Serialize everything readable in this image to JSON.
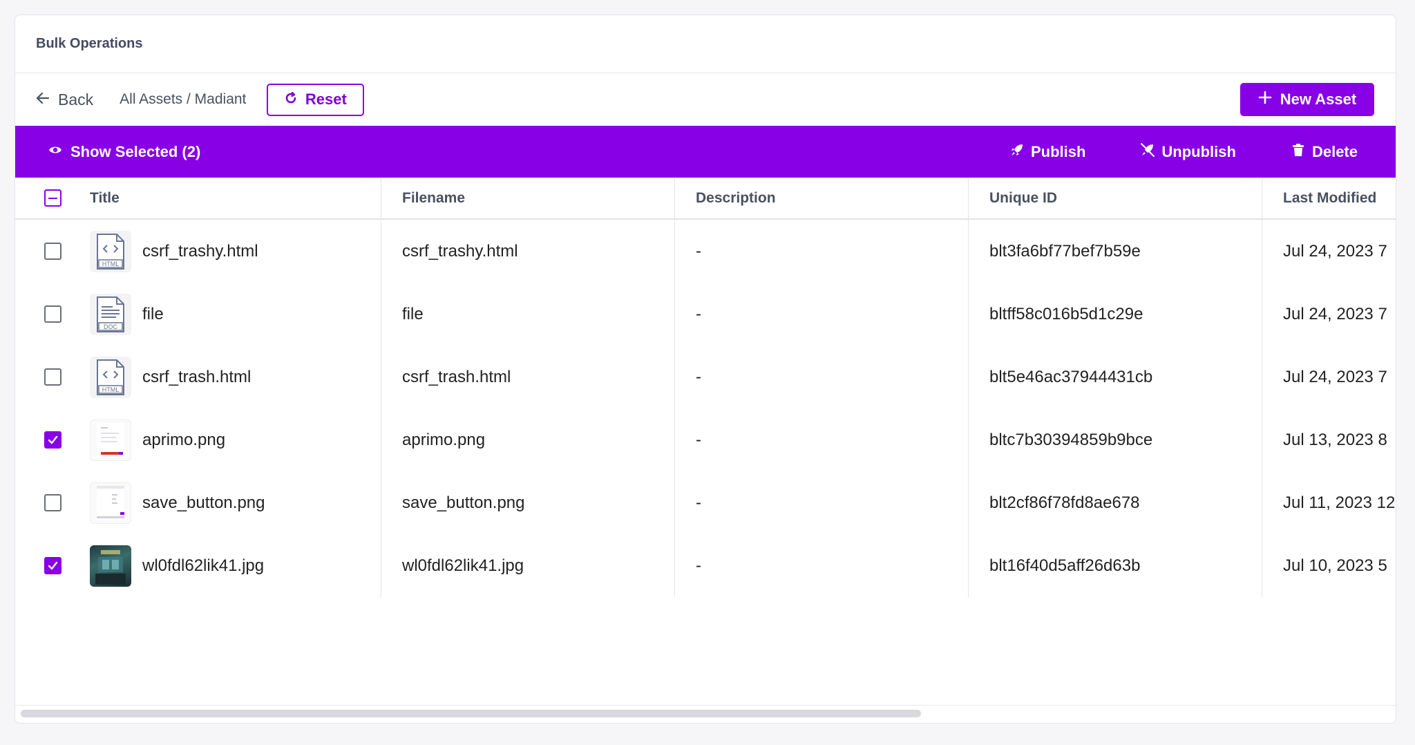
{
  "header": {
    "title": "Bulk Operations"
  },
  "toolbar": {
    "back_label": "Back",
    "breadcrumb": "All Assets / Madiant",
    "reset_label": "Reset",
    "new_asset_label": "New Asset"
  },
  "action_bar": {
    "show_selected_label": "Show Selected (2)",
    "publish_label": "Publish",
    "unpublish_label": "Unpublish",
    "delete_label": "Delete"
  },
  "table": {
    "columns": [
      "Title",
      "Filename",
      "Description",
      "Unique ID",
      "Last Modified"
    ],
    "rows": [
      {
        "title": "csrf_trashy.html",
        "filename": "csrf_trashy.html",
        "description": "-",
        "uid": "blt3fa6bf77bef7b59e",
        "modified": "Jul 24, 2023 7",
        "icon": "html-file-icon",
        "icon_label": "HTML",
        "checked": false
      },
      {
        "title": "file",
        "filename": "file",
        "description": "-",
        "uid": "bltff58c016b5d1c29e",
        "modified": "Jul 24, 2023 7",
        "icon": "doc-file-icon",
        "icon_label": "DOC",
        "checked": false
      },
      {
        "title": "csrf_trash.html",
        "filename": "csrf_trash.html",
        "description": "-",
        "uid": "blt5e46ac37944431cb",
        "modified": "Jul 24, 2023 7",
        "icon": "html-file-icon",
        "icon_label": "HTML",
        "checked": false
      },
      {
        "title": "aprimo.png",
        "filename": "aprimo.png",
        "description": "-",
        "uid": "bltc7b30394859b9bce",
        "modified": "Jul 13, 2023 8",
        "icon": "image-thumbnail",
        "checked": true
      },
      {
        "title": "save_button.png",
        "filename": "save_button.png",
        "description": "-",
        "uid": "blt2cf86f78fd8ae678",
        "modified": "Jul 11, 2023 12",
        "icon": "image-thumbnail",
        "checked": false
      },
      {
        "title": "wl0fdl62lik41.jpg",
        "filename": "wl0fdl62lik41.jpg",
        "description": "-",
        "uid": "blt16f40d5aff26d63b",
        "modified": "Jul 10, 2023 5",
        "icon": "photo-thumbnail",
        "checked": true
      }
    ]
  },
  "colors": {
    "accent": "#8700e6",
    "text": "#222222",
    "muted_text": "#475161",
    "border": "#e3e3ea"
  }
}
